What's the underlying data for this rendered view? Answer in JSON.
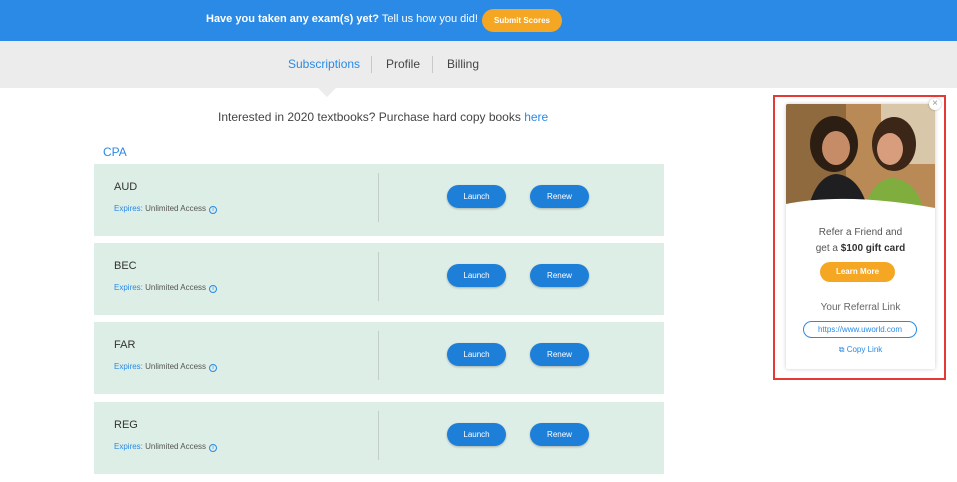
{
  "banner": {
    "question": "Have you taken any exam(s) yet?",
    "prompt": "Tell us how you did!",
    "submit_label": "Submit Scores"
  },
  "tabs": [
    {
      "label": "Subscriptions",
      "active": true
    },
    {
      "label": "Profile",
      "active": false
    },
    {
      "label": "Billing",
      "active": false
    }
  ],
  "notice": {
    "text": "Interested in 2020 textbooks? Purchase hard copy books ",
    "link": "here"
  },
  "section": "CPA",
  "courses": [
    {
      "name": "AUD",
      "expires_label": "Expires:",
      "expires_value": "Unlimited Access",
      "launch": "Launch",
      "renew": "Renew"
    },
    {
      "name": "BEC",
      "expires_label": "Expires:",
      "expires_value": "Unlimited Access",
      "launch": "Launch",
      "renew": "Renew"
    },
    {
      "name": "FAR",
      "expires_label": "Expires:",
      "expires_value": "Unlimited Access",
      "launch": "Launch",
      "renew": "Renew"
    },
    {
      "name": "REG",
      "expires_label": "Expires:",
      "expires_value": "Unlimited Access",
      "launch": "Launch",
      "renew": "Renew"
    }
  ],
  "referral": {
    "line1": "Refer a Friend and",
    "line2_prefix": "get a ",
    "line2_bold": "$100 gift card",
    "learn_more": "Learn More",
    "link_label": "Your Referral Link",
    "link_url": "https://www.uworld.com",
    "copy_label": "Copy Link",
    "close": "×"
  },
  "colors": {
    "banner": "#2a8ae6",
    "accent_orange": "#f5a623",
    "card_bg": "#ddeee6",
    "button_blue": "#1e7fd9",
    "highlight_border": "#e53935"
  }
}
